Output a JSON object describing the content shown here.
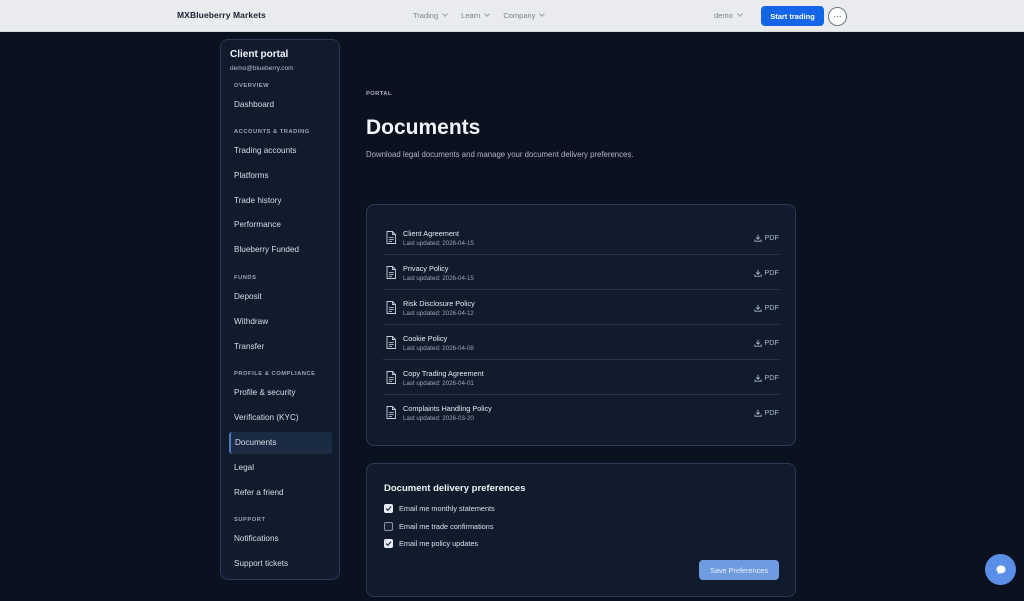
{
  "header": {
    "brand": "MXBlueberry Markets",
    "nav": [
      {
        "label": "Trading"
      },
      {
        "label": "Learn"
      },
      {
        "label": "Company"
      }
    ],
    "account_mode": "demo",
    "start_trading_label": "Start trading",
    "more_label": "···"
  },
  "sidebar": {
    "title": "Client portal",
    "email": "demo@blueberry.com",
    "sections": [
      {
        "label": "OVERVIEW",
        "items": [
          "Dashboard"
        ]
      },
      {
        "label": "ACCOUNTS & TRADING",
        "items": [
          "Trading accounts",
          "Platforms",
          "Trade history",
          "Performance",
          "Blueberry Funded"
        ]
      },
      {
        "label": "FUNDS",
        "items": [
          "Deposit",
          "Withdraw",
          "Transfer"
        ]
      },
      {
        "label": "PROFILE & COMPLIANCE",
        "items": [
          "Profile & security",
          "Verification (KYC)",
          "Documents",
          "Legal",
          "Refer a friend"
        ]
      },
      {
        "label": "SUPPORT",
        "items": [
          "Notifications",
          "Support tickets"
        ]
      }
    ],
    "active_item": "Documents"
  },
  "main": {
    "breadcrumb": "PORTAL",
    "title": "Documents",
    "subtitle": "Download legal documents and manage your document delivery preferences.",
    "documents": [
      {
        "name": "Client Agreement",
        "updated": "Last updated: 2026-04-15",
        "action": "PDF"
      },
      {
        "name": "Privacy Policy",
        "updated": "Last updated: 2026-04-15",
        "action": "PDF"
      },
      {
        "name": "Risk Disclosure Policy",
        "updated": "Last updated: 2026-04-12",
        "action": "PDF"
      },
      {
        "name": "Cookie Policy",
        "updated": "Last updated: 2026-04-08",
        "action": "PDF"
      },
      {
        "name": "Copy Trading Agreement",
        "updated": "Last updated: 2026-04-01",
        "action": "PDF"
      },
      {
        "name": "Complaints Handling Policy",
        "updated": "Last updated: 2026-03-20",
        "action": "PDF"
      }
    ],
    "preferences": {
      "title": "Document delivery preferences",
      "options": [
        {
          "label": "Email me monthly statements",
          "checked": true
        },
        {
          "label": "Email me trade confirmations",
          "checked": false
        },
        {
          "label": "Email me policy updates",
          "checked": true
        }
      ],
      "save_label": "Save Preferences"
    }
  },
  "colors": {
    "background": "#0a121f",
    "card": "#101b2c",
    "accent": "#1565e9",
    "save_button": "#6f9be0"
  }
}
